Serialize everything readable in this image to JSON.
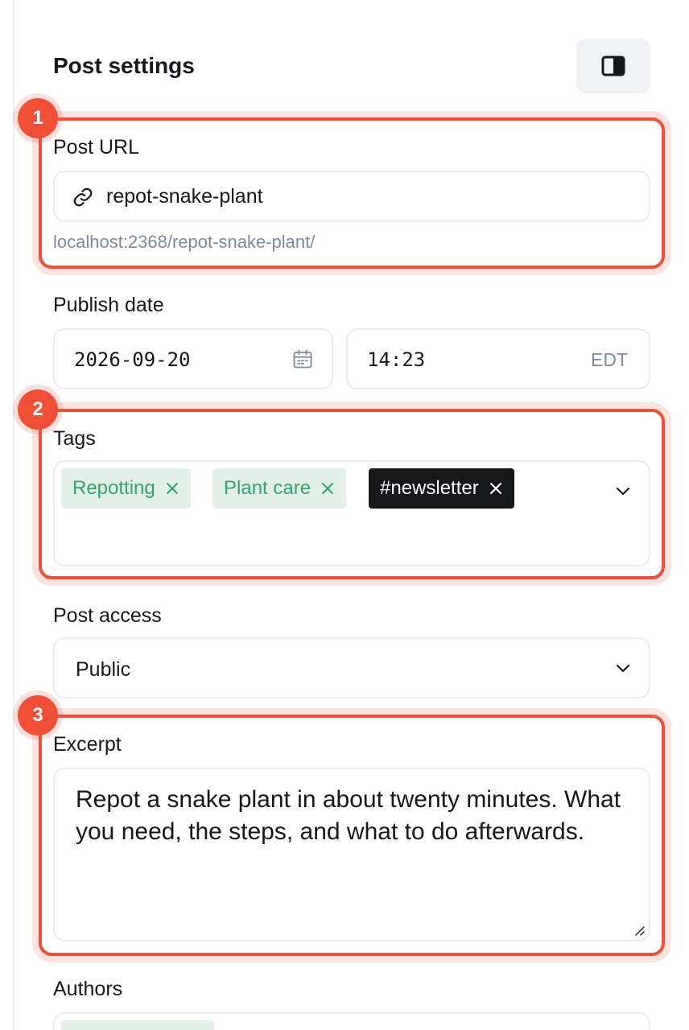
{
  "header": {
    "title": "Post settings",
    "toggle_icon": "sidebar-toggle-icon"
  },
  "post_url": {
    "label": "Post URL",
    "value": "repot-snake-plant",
    "hint": "localhost:2368/repot-snake-plant/"
  },
  "publish_date": {
    "label": "Publish date",
    "date": "2026-09-20",
    "time": "14:23",
    "timezone": "EDT"
  },
  "tags": {
    "label": "Tags",
    "items": [
      {
        "label": "Repotting",
        "style": "public"
      },
      {
        "label": "Plant care",
        "style": "public"
      },
      {
        "label": "#newsletter",
        "style": "internal"
      }
    ]
  },
  "post_access": {
    "label": "Post access",
    "value": "Public"
  },
  "excerpt": {
    "label": "Excerpt",
    "value": "Repot a snake plant in about twenty minutes. What you need, the steps, and what to do afterwards."
  },
  "authors": {
    "label": "Authors"
  },
  "callouts": [
    "1",
    "2",
    "3"
  ],
  "colors": {
    "accent": "#f04f37",
    "tag_green_bg": "#e2f0e7",
    "tag_green_text": "#30a46c",
    "tag_dark_bg": "#15171a"
  }
}
